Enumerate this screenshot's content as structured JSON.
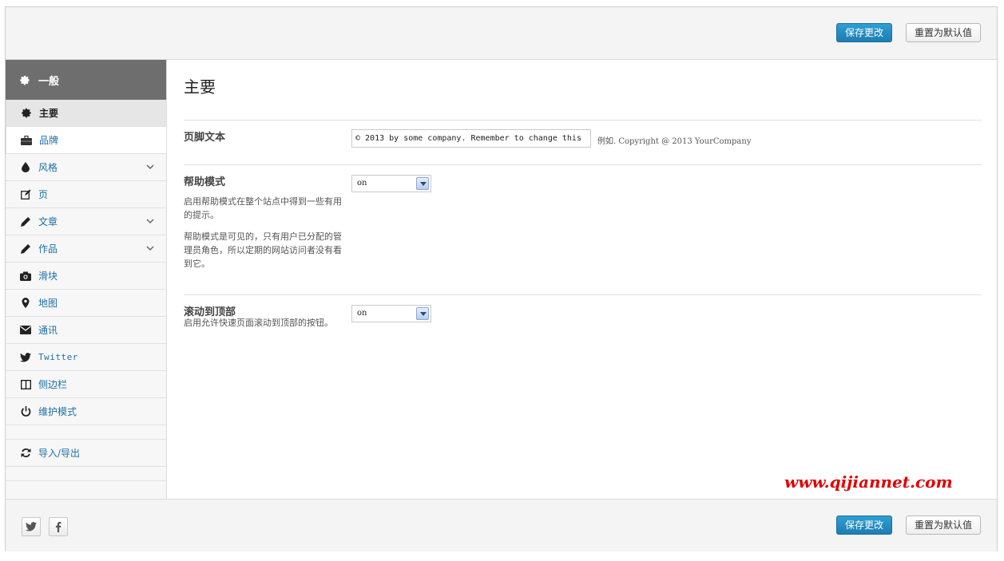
{
  "header": {
    "save_label": "保存更改",
    "reset_label": "重置为默认值"
  },
  "footer": {
    "save_label": "保存更改",
    "reset_label": "重置为默认值"
  },
  "sidebar": {
    "section_title": "一般",
    "items": [
      {
        "label": "主要",
        "icon": "gear-icon"
      },
      {
        "label": "品牌",
        "icon": "briefcase-icon"
      },
      {
        "label": "风格",
        "icon": "drop-icon"
      },
      {
        "label": "页",
        "icon": "edit-icon"
      },
      {
        "label": "文章",
        "icon": "pencil-icon"
      },
      {
        "label": "作品",
        "icon": "pencil-icon"
      },
      {
        "label": "滑块",
        "icon": "camera-icon"
      },
      {
        "label": "地图",
        "icon": "map-marker-icon"
      },
      {
        "label": "通讯",
        "icon": "envelope-icon"
      },
      {
        "label": "Twitter",
        "icon": "twitter-icon"
      },
      {
        "label": "侧边栏",
        "icon": "columns-icon"
      },
      {
        "label": "维护模式",
        "icon": "power-icon"
      },
      {
        "label": "导入/导出",
        "icon": "refresh-icon"
      }
    ]
  },
  "main": {
    "title": "主要",
    "footer_text": {
      "label": "页脚文本",
      "value": "© 2013 by some company. Remember to change this",
      "hint": "例如. Copyright @ 2013 YourCompany"
    },
    "help_mode": {
      "label": "帮助模式",
      "desc1": "启用帮助模式在整个站点中得到一些有用的提示。",
      "desc2": "帮助模式是可见的，只有用户已分配的管理员角色，所以定期的网站访问者没有看到它。",
      "value": "on"
    },
    "scroll_top": {
      "label": "滚动到顶部",
      "desc": "启用允许快速页面滚动到顶部的按钮。",
      "value": "on"
    }
  },
  "watermark": "www.qijiannet.com",
  "colors": {
    "primary": "#1e7db2",
    "sidebar_head": "#6e6e6e",
    "link": "#1e6fa5",
    "watermark": "#e00000"
  }
}
